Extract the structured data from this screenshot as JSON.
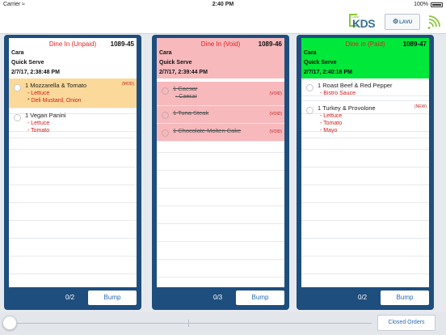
{
  "statusbar": {
    "carrier": "Carrier",
    "time": "2:40 PM",
    "battery": "100%"
  },
  "header": {
    "logo_small": "Lavu",
    "logo_text": "KDS",
    "lavu_button": "LAVU"
  },
  "tickets": [
    {
      "status": "Dine In (Unpaid)",
      "order_no": "1089-45",
      "server": "Cara",
      "type": "Quick Serve",
      "time": "2/7/17, 2:38:48 PM",
      "count": "0/2",
      "bump": "Bump",
      "items": [
        {
          "name": "1 Mozzarella & Tomato",
          "tag": "(MOD)",
          "mods": [
            "- Lettuce",
            "* Deli Mustard, Onion"
          ]
        },
        {
          "name": "1 Vegan Panini",
          "tag": "",
          "mods": [
            "- Lettuce",
            "- Tomato"
          ]
        }
      ]
    },
    {
      "status": "Dine In (Void)",
      "order_no": "1089-46",
      "server": "Cara",
      "type": "Quick Serve",
      "time": "2/7/17, 2:39:44 PM",
      "count": "0/3",
      "bump": "Bump",
      "items": [
        {
          "name": "1 Caesar",
          "tag": "(VOID)",
          "mods": [
            "- Caesar"
          ]
        },
        {
          "name": "1 Tuna Steak",
          "tag": "(VOID)",
          "mods": []
        },
        {
          "name": "1 Chocolate Molten Cake",
          "tag": "(VOID)",
          "mods": []
        }
      ]
    },
    {
      "status": "Dine In (Paid)",
      "order_no": "1089-47",
      "server": "Cara",
      "type": "Quick Serve",
      "time": "2/7/17, 2:40:16 PM",
      "count": "0/2",
      "bump": "Bump",
      "items": [
        {
          "name": "1 Roast Beef & Red Pepper",
          "tag": "",
          "mods": [
            "- Bistro Sauce"
          ]
        },
        {
          "name": "1 Turkey & Provolone",
          "tag": "(NEW)",
          "mods": [
            "- Lettuce",
            "- Tomato",
            "- Mayo"
          ]
        }
      ]
    }
  ],
  "footer": {
    "closed_orders": "Closed Orders"
  },
  "colors": {
    "ticket_frame": "#1e4e7e",
    "unpaid_header": "#ffffff",
    "void_header": "#f7b9bc",
    "paid_header": "#00e83a",
    "mod_item": "#fbd99a",
    "status_red": "#e02020",
    "accent_blue": "#2a6bb0"
  }
}
